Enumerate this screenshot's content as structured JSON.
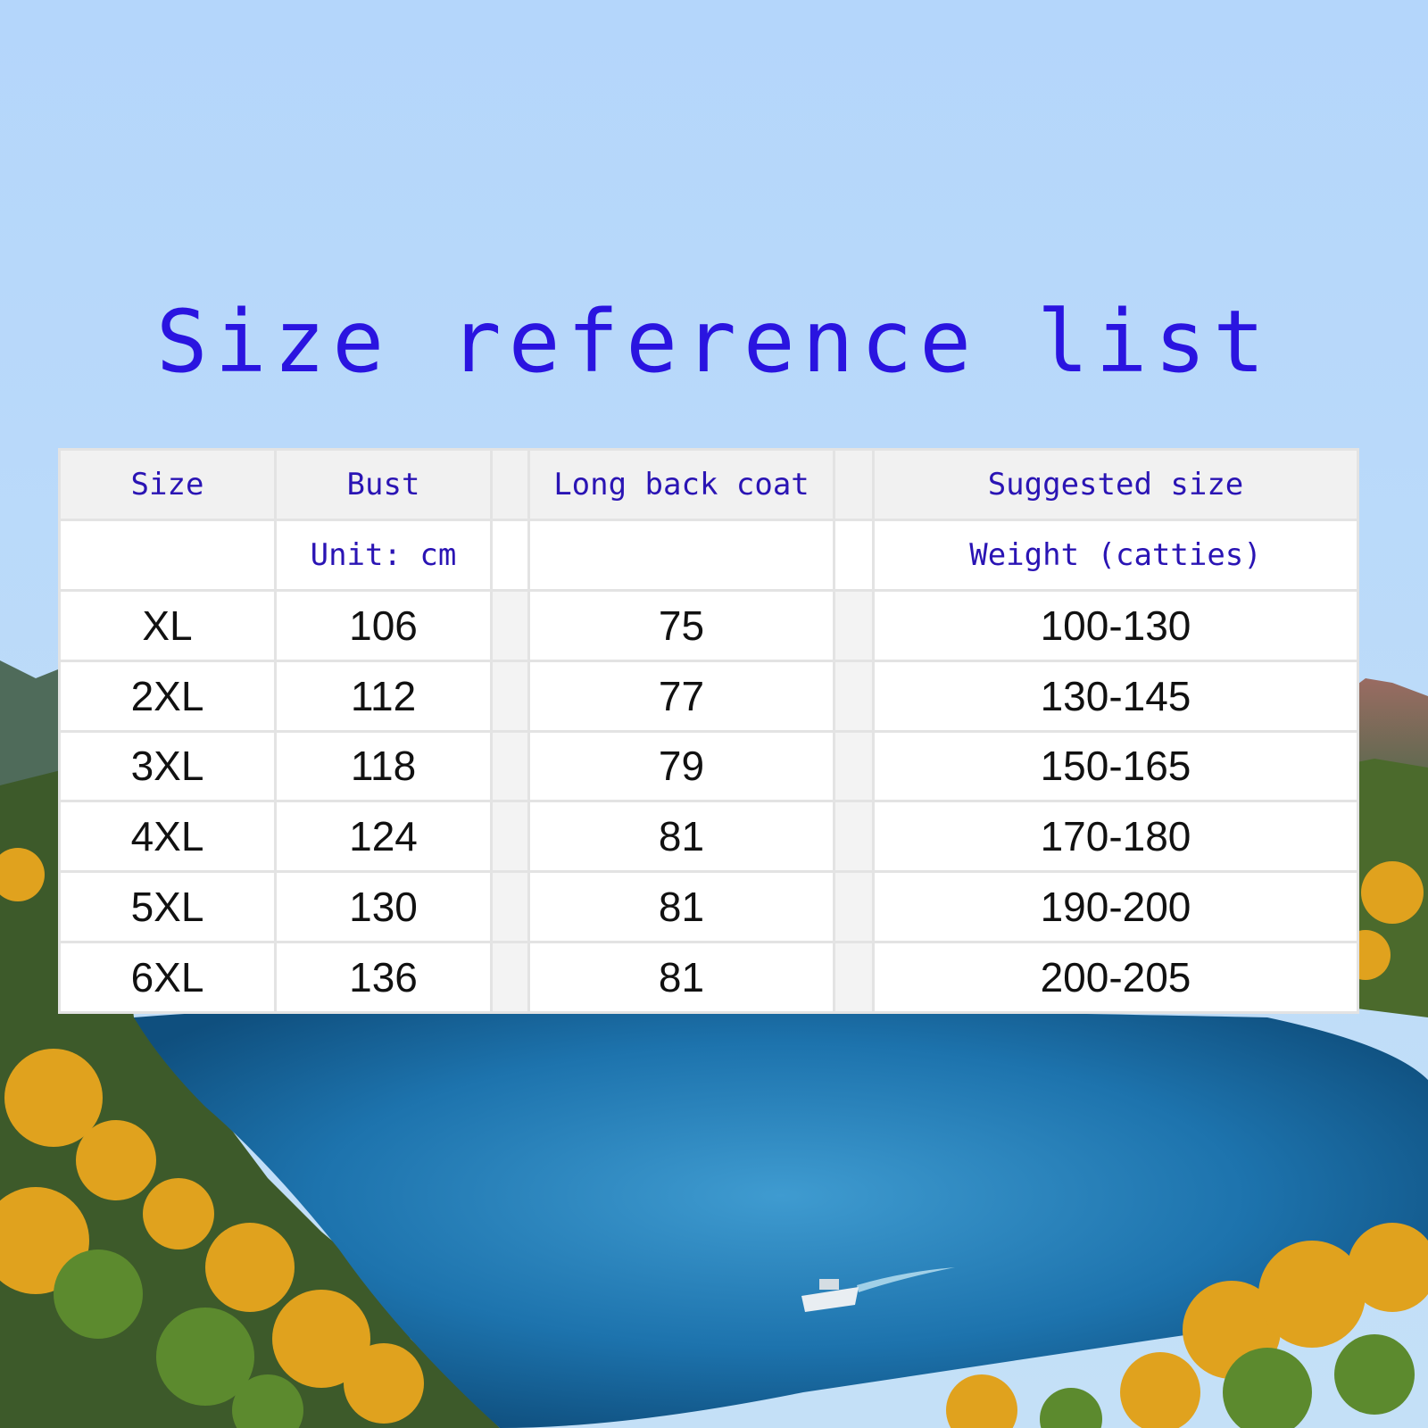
{
  "title": "Size reference list",
  "table": {
    "headers": [
      "Size",
      "Bust",
      "Long back coat",
      "Suggested size"
    ],
    "units": [
      "",
      "Unit: cm",
      "",
      "Weight (catties)"
    ],
    "rows": [
      [
        "XL",
        "106",
        "75",
        "100-130"
      ],
      [
        "2XL",
        "112",
        "77",
        "130-145"
      ],
      [
        "3XL",
        "118",
        "79",
        "150-165"
      ],
      [
        "4XL",
        "124",
        "81",
        "170-180"
      ],
      [
        "5XL",
        "130",
        "81",
        "190-200"
      ],
      [
        "6XL",
        "136",
        "81",
        "200-205"
      ]
    ]
  },
  "colors": {
    "sky": "#b9daf8",
    "title": "#2a14e0",
    "header_text": "#2a14b4",
    "body_text": "#111111",
    "lake": "#1d73ad"
  },
  "background_scene": "mountain-lake-landscape-with-autumn-trees-and-boat"
}
